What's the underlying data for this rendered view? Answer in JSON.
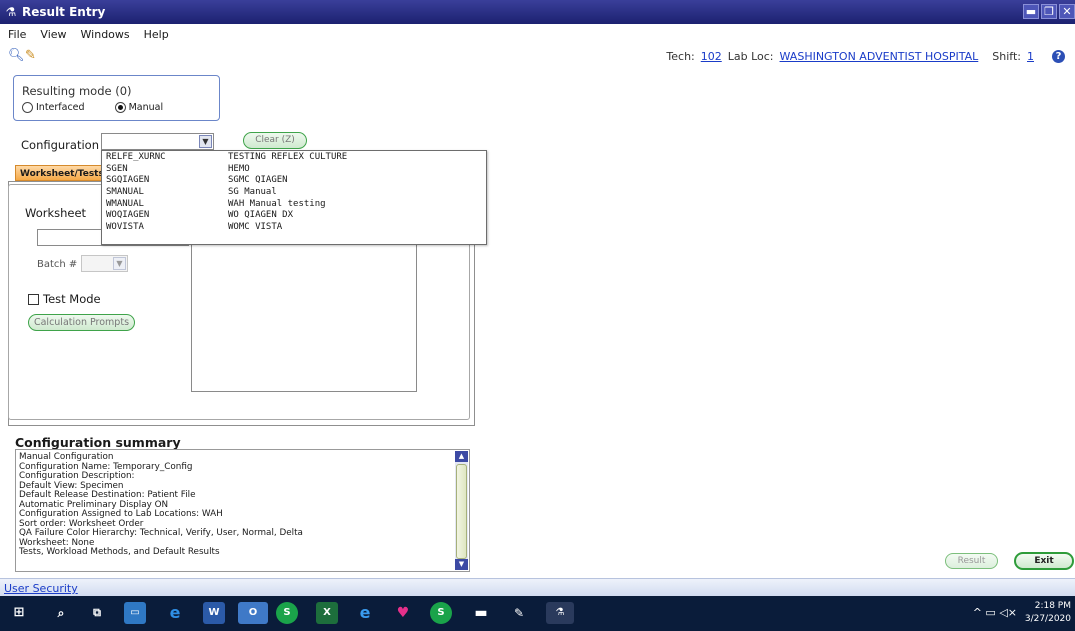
{
  "window": {
    "title": "Result Entry",
    "app_icon": "beaker-icon"
  },
  "menu": [
    {
      "label": "File",
      "key": "F"
    },
    {
      "label": "View",
      "key": "V"
    },
    {
      "label": "Windows",
      "key": "W"
    },
    {
      "label": "Help",
      "key": "H"
    }
  ],
  "tech_info": {
    "tech_label": "Tech:",
    "tech_value": "102",
    "lab_label": "Lab Loc:",
    "lab_value": "WASHINGTON ADVENTIST HOSPITAL",
    "shift_label": "Shift:",
    "shift_value": "1"
  },
  "resulting_mode": {
    "title": "Resulting mode (0)",
    "options": [
      {
        "label": "Interfaced",
        "selected": false
      },
      {
        "label": "Manual",
        "selected": true
      }
    ]
  },
  "configuration": {
    "label": "Configuration",
    "clear_button": "Clear (Z)",
    "dropdown_items": [
      {
        "code": "RELFE_XURNC",
        "name": "TESTING REFLEX CULTURE"
      },
      {
        "code": "SGEN",
        "name": "HEMO"
      },
      {
        "code": "SGQIAGEN",
        "name": "SGMC QIAGEN"
      },
      {
        "code": "SMANUAL",
        "name": "SG Manual"
      },
      {
        "code": "WMANUAL",
        "name": "WAH Manual testing"
      },
      {
        "code": "WOQIAGEN",
        "name": "WO QIAGEN DX"
      },
      {
        "code": "WOVISTA",
        "name": "WOMC VISTA"
      }
    ]
  },
  "worksheet_tab": {
    "label": "Worksheet/Tests"
  },
  "worksheet": {
    "label": "Worksheet",
    "batch_label": "Batch #",
    "test_mode_label": "Test Mode",
    "calc_button": "Calculation Prompts"
  },
  "summary": {
    "title": "Configuration summary",
    "lines": [
      "Manual Configuration",
      "Configuration Name: Temporary_Config",
      "Configuration Description:",
      "Default View: Specimen",
      "Default Release Destination: Patient File",
      "Automatic Preliminary Display ON",
      "Configuration Assigned to Lab Locations: WAH",
      "Sort order: Worksheet Order",
      "QA Failure Color Hierarchy: Technical, Verify, User, Normal, Delta",
      "Worksheet: None",
      "Tests, Workload Methods, and Default Results"
    ]
  },
  "buttons": {
    "result": "Result",
    "exit": "Exit"
  },
  "status_bar": {
    "link": "User Security"
  },
  "taskbar": {
    "time": "2:18 PM",
    "date": "3/27/2020",
    "items": [
      "windows-start-icon",
      "search-icon",
      "task-view-icon",
      "file-explorer-icon",
      "edge-icon",
      "word-icon",
      "outlook-icon",
      "app-s-icon",
      "excel-icon",
      "ie-icon",
      "maps-icon",
      "app-s2-icon",
      "mail-icon",
      "paint-icon",
      "lab-app-icon"
    ]
  }
}
